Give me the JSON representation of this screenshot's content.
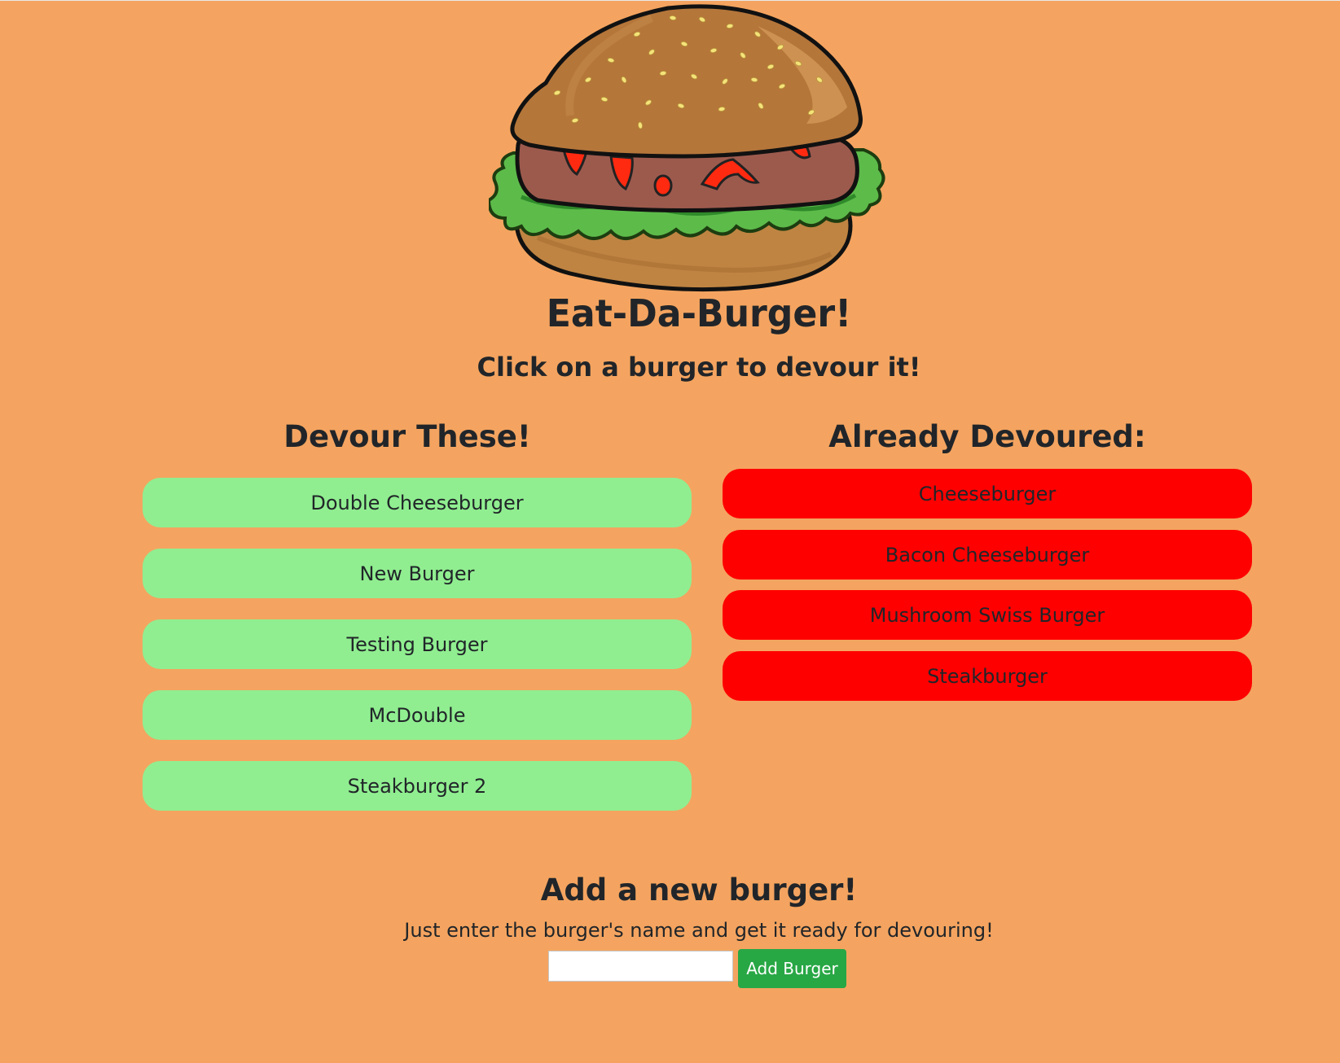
{
  "header": {
    "title": "Eat-Da-Burger!",
    "subtitle": "Click on a burger to devour it!"
  },
  "colors": {
    "background": "#f4a460",
    "fresh_button": "#90ee90",
    "devoured_button": "#ff0000",
    "add_button": "#28a745"
  },
  "logo": {
    "icon": "burger-icon"
  },
  "devour": {
    "heading": "Devour These!",
    "items": [
      {
        "label": "Double Cheeseburger"
      },
      {
        "label": "New Burger"
      },
      {
        "label": "Testing Burger"
      },
      {
        "label": "McDouble"
      },
      {
        "label": "Steakburger 2"
      }
    ]
  },
  "devoured": {
    "heading": "Already Devoured:",
    "items": [
      {
        "label": "Cheeseburger"
      },
      {
        "label": "Bacon Cheeseburger"
      },
      {
        "label": "Mushroom Swiss Burger"
      },
      {
        "label": "Steakburger"
      }
    ]
  },
  "add_form": {
    "heading": "Add a new burger!",
    "subtitle": "Just enter the burger's name and get it ready for devouring!",
    "input_value": "",
    "button_label": "Add Burger"
  }
}
